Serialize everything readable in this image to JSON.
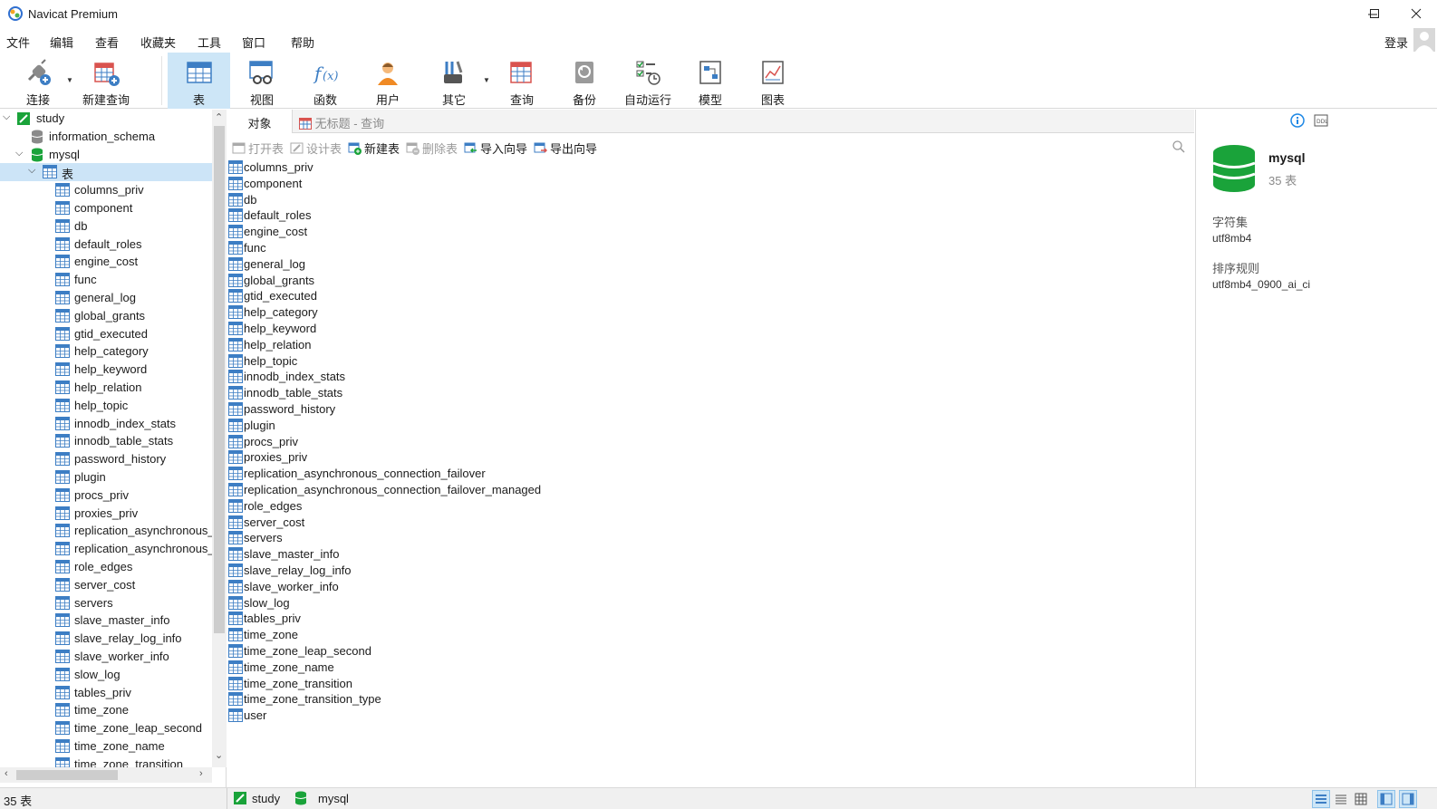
{
  "window": {
    "title": "Navicat Premium"
  },
  "menu": [
    "文件",
    "编辑",
    "查看",
    "收藏夹",
    "工具",
    "窗口",
    "帮助"
  ],
  "account": {
    "login_label": "登录"
  },
  "toolbar": {
    "connect": "连接",
    "new_query": "新建查询",
    "table": "表",
    "view": "视图",
    "function": "函数",
    "user": "用户",
    "other": "其它",
    "query": "查询",
    "backup": "备份",
    "automation": "自动运行",
    "model": "模型",
    "chart": "图表"
  },
  "tree": {
    "connection": "study",
    "databases": [
      "information_schema",
      "mysql"
    ],
    "tables_node": "表",
    "tables": [
      "columns_priv",
      "component",
      "db",
      "default_roles",
      "engine_cost",
      "func",
      "general_log",
      "global_grants",
      "gtid_executed",
      "help_category",
      "help_keyword",
      "help_relation",
      "help_topic",
      "innodb_index_stats",
      "innodb_table_stats",
      "password_history",
      "plugin",
      "procs_priv",
      "proxies_priv",
      "replication_asynchronous_",
      "replication_asynchronous_",
      "role_edges",
      "server_cost",
      "servers",
      "slave_master_info",
      "slave_relay_log_info",
      "slave_worker_info",
      "slow_log",
      "tables_priv",
      "time_zone",
      "time_zone_leap_second",
      "time_zone_name",
      "time_zone_transition"
    ]
  },
  "tabs": {
    "objects": "对象",
    "query": "无标题 - 查询"
  },
  "object_toolbar": {
    "open_table": "打开表",
    "design_table": "设计表",
    "new_table": "新建表",
    "delete_table": "删除表",
    "import_wizard": "导入向导",
    "export_wizard": "导出向导"
  },
  "objects": [
    "columns_priv",
    "component",
    "db",
    "default_roles",
    "engine_cost",
    "func",
    "general_log",
    "global_grants",
    "gtid_executed",
    "help_category",
    "help_keyword",
    "help_relation",
    "help_topic",
    "innodb_index_stats",
    "innodb_table_stats",
    "password_history",
    "plugin",
    "procs_priv",
    "proxies_priv",
    "replication_asynchronous_connection_failover",
    "replication_asynchronous_connection_failover_managed",
    "role_edges",
    "server_cost",
    "servers",
    "slave_master_info",
    "slave_relay_log_info",
    "slave_worker_info",
    "slow_log",
    "tables_priv",
    "time_zone",
    "time_zone_leap_second",
    "time_zone_name",
    "time_zone_transition",
    "time_zone_transition_type",
    "user"
  ],
  "info": {
    "db_name": "mysql",
    "table_count": "35 表",
    "charset_label": "字符集",
    "charset_value": "utf8mb4",
    "collation_label": "排序规则",
    "collation_value": "utf8mb4_0900_ai_ci"
  },
  "status": {
    "count": "35 表",
    "connection": "study",
    "database": "mysql"
  },
  "colors": {
    "accent": "#cde6f7",
    "db_green": "#1aa33a",
    "table_blue": "#3d7ec4"
  }
}
